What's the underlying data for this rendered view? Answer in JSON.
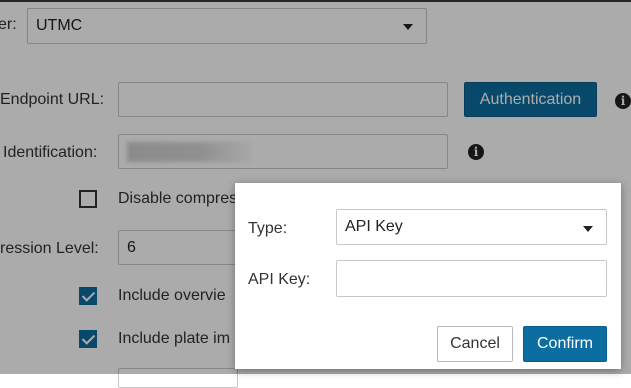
{
  "form": {
    "provider_label": "er:",
    "provider_value": "UTMC",
    "endpoint_label": "Endpoint URL:",
    "endpoint_value": "",
    "authentication_button": "Authentication",
    "identification_label": "Identification:",
    "disable_compression_label": "Disable compres",
    "disable_compression_checked": false,
    "compression_level_label": "ression Level:",
    "compression_level_value": "6",
    "include_overview_label": "Include overvie",
    "include_overview_checked": true,
    "include_plate_label": "Include plate im",
    "include_plate_checked": true
  },
  "dialog": {
    "type_label": "Type:",
    "type_value": "API Key",
    "api_key_label": "API Key:",
    "api_key_value": "",
    "cancel_label": "Cancel",
    "confirm_label": "Confirm"
  },
  "colors": {
    "accent": "#0c6ea0",
    "overlay": "rgba(0,0,0,0.33)"
  },
  "icons": {
    "info": "info-circle-icon",
    "caret": "chevron-down-icon",
    "check": "checkmark-icon"
  }
}
